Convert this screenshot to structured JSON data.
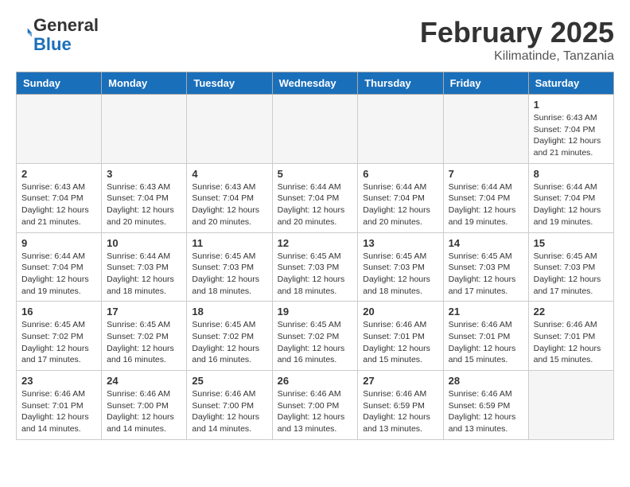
{
  "header": {
    "logo_line1": "General",
    "logo_line2": "Blue",
    "month_title": "February 2025",
    "location": "Kilimatinde, Tanzania"
  },
  "weekdays": [
    "Sunday",
    "Monday",
    "Tuesday",
    "Wednesday",
    "Thursday",
    "Friday",
    "Saturday"
  ],
  "weeks": [
    [
      {
        "day": "",
        "info": ""
      },
      {
        "day": "",
        "info": ""
      },
      {
        "day": "",
        "info": ""
      },
      {
        "day": "",
        "info": ""
      },
      {
        "day": "",
        "info": ""
      },
      {
        "day": "",
        "info": ""
      },
      {
        "day": "1",
        "info": "Sunrise: 6:43 AM\nSunset: 7:04 PM\nDaylight: 12 hours\nand 21 minutes."
      }
    ],
    [
      {
        "day": "2",
        "info": "Sunrise: 6:43 AM\nSunset: 7:04 PM\nDaylight: 12 hours\nand 21 minutes."
      },
      {
        "day": "3",
        "info": "Sunrise: 6:43 AM\nSunset: 7:04 PM\nDaylight: 12 hours\nand 20 minutes."
      },
      {
        "day": "4",
        "info": "Sunrise: 6:43 AM\nSunset: 7:04 PM\nDaylight: 12 hours\nand 20 minutes."
      },
      {
        "day": "5",
        "info": "Sunrise: 6:44 AM\nSunset: 7:04 PM\nDaylight: 12 hours\nand 20 minutes."
      },
      {
        "day": "6",
        "info": "Sunrise: 6:44 AM\nSunset: 7:04 PM\nDaylight: 12 hours\nand 20 minutes."
      },
      {
        "day": "7",
        "info": "Sunrise: 6:44 AM\nSunset: 7:04 PM\nDaylight: 12 hours\nand 19 minutes."
      },
      {
        "day": "8",
        "info": "Sunrise: 6:44 AM\nSunset: 7:04 PM\nDaylight: 12 hours\nand 19 minutes."
      }
    ],
    [
      {
        "day": "9",
        "info": "Sunrise: 6:44 AM\nSunset: 7:04 PM\nDaylight: 12 hours\nand 19 minutes."
      },
      {
        "day": "10",
        "info": "Sunrise: 6:44 AM\nSunset: 7:03 PM\nDaylight: 12 hours\nand 18 minutes."
      },
      {
        "day": "11",
        "info": "Sunrise: 6:45 AM\nSunset: 7:03 PM\nDaylight: 12 hours\nand 18 minutes."
      },
      {
        "day": "12",
        "info": "Sunrise: 6:45 AM\nSunset: 7:03 PM\nDaylight: 12 hours\nand 18 minutes."
      },
      {
        "day": "13",
        "info": "Sunrise: 6:45 AM\nSunset: 7:03 PM\nDaylight: 12 hours\nand 18 minutes."
      },
      {
        "day": "14",
        "info": "Sunrise: 6:45 AM\nSunset: 7:03 PM\nDaylight: 12 hours\nand 17 minutes."
      },
      {
        "day": "15",
        "info": "Sunrise: 6:45 AM\nSunset: 7:03 PM\nDaylight: 12 hours\nand 17 minutes."
      }
    ],
    [
      {
        "day": "16",
        "info": "Sunrise: 6:45 AM\nSunset: 7:02 PM\nDaylight: 12 hours\nand 17 minutes."
      },
      {
        "day": "17",
        "info": "Sunrise: 6:45 AM\nSunset: 7:02 PM\nDaylight: 12 hours\nand 16 minutes."
      },
      {
        "day": "18",
        "info": "Sunrise: 6:45 AM\nSunset: 7:02 PM\nDaylight: 12 hours\nand 16 minutes."
      },
      {
        "day": "19",
        "info": "Sunrise: 6:45 AM\nSunset: 7:02 PM\nDaylight: 12 hours\nand 16 minutes."
      },
      {
        "day": "20",
        "info": "Sunrise: 6:46 AM\nSunset: 7:01 PM\nDaylight: 12 hours\nand 15 minutes."
      },
      {
        "day": "21",
        "info": "Sunrise: 6:46 AM\nSunset: 7:01 PM\nDaylight: 12 hours\nand 15 minutes."
      },
      {
        "day": "22",
        "info": "Sunrise: 6:46 AM\nSunset: 7:01 PM\nDaylight: 12 hours\nand 15 minutes."
      }
    ],
    [
      {
        "day": "23",
        "info": "Sunrise: 6:46 AM\nSunset: 7:01 PM\nDaylight: 12 hours\nand 14 minutes."
      },
      {
        "day": "24",
        "info": "Sunrise: 6:46 AM\nSunset: 7:00 PM\nDaylight: 12 hours\nand 14 minutes."
      },
      {
        "day": "25",
        "info": "Sunrise: 6:46 AM\nSunset: 7:00 PM\nDaylight: 12 hours\nand 14 minutes."
      },
      {
        "day": "26",
        "info": "Sunrise: 6:46 AM\nSunset: 7:00 PM\nDaylight: 12 hours\nand 13 minutes."
      },
      {
        "day": "27",
        "info": "Sunrise: 6:46 AM\nSunset: 6:59 PM\nDaylight: 12 hours\nand 13 minutes."
      },
      {
        "day": "28",
        "info": "Sunrise: 6:46 AM\nSunset: 6:59 PM\nDaylight: 12 hours\nand 13 minutes."
      },
      {
        "day": "",
        "info": ""
      }
    ]
  ]
}
